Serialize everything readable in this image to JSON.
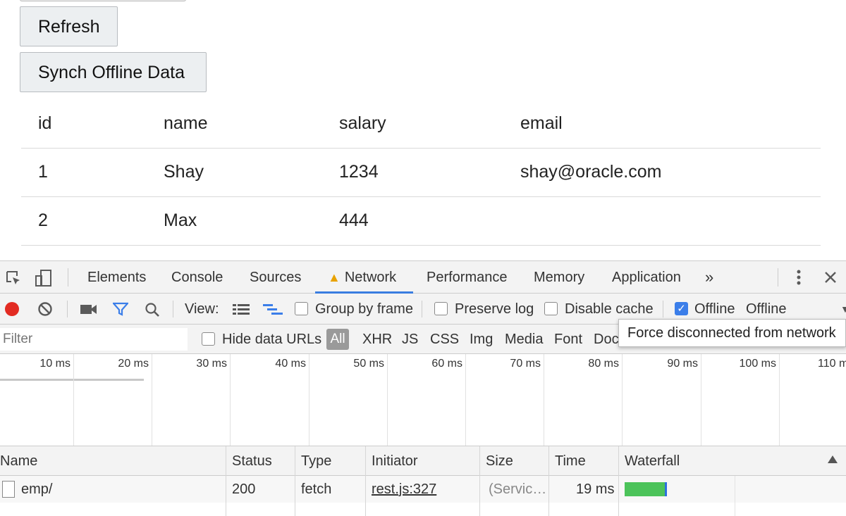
{
  "page": {
    "buttons": {
      "refresh": "Refresh",
      "synch": "Synch Offline Data"
    },
    "table": {
      "columns": [
        "id",
        "name",
        "salary",
        "email"
      ],
      "rows": [
        {
          "id": "1",
          "name": "Shay",
          "salary": "1234",
          "email": "shay@oracle.com"
        },
        {
          "id": "2",
          "name": "Max",
          "salary": "444",
          "email": ""
        }
      ]
    }
  },
  "devtools": {
    "tabs": [
      "Elements",
      "Console",
      "Sources",
      "Network",
      "Performance",
      "Memory",
      "Application"
    ],
    "active_tab": "Network",
    "more_tabs": "»",
    "toolbar": {
      "view_label": "View:",
      "group_by_frame": "Group by frame",
      "preserve_log": "Preserve log",
      "disable_cache": "Disable cache",
      "offline_checkbox": "Offline",
      "throttle_value": "Offline"
    },
    "filterbar": {
      "filter_placeholder": "Filter",
      "hide_data_urls": "Hide data URLs",
      "types": [
        "All",
        "XHR",
        "JS",
        "CSS",
        "Img",
        "Media",
        "Font",
        "Doc"
      ]
    },
    "tooltip": "Force disconnected from network",
    "timeline_ticks": [
      "10 ms",
      "20 ms",
      "30 ms",
      "40 ms",
      "50 ms",
      "60 ms",
      "70 ms",
      "80 ms",
      "90 ms",
      "100 ms",
      "110 ms"
    ],
    "grid": {
      "headers": [
        "Name",
        "Status",
        "Type",
        "Initiator",
        "Size",
        "Time",
        "Waterfall"
      ],
      "rows": [
        {
          "name": "emp/",
          "status": "200",
          "type": "fetch",
          "initiator": "rest.js:327",
          "size": "(Servic…",
          "time": "19 ms"
        }
      ]
    },
    "colors": {
      "accent": "#3a7de0",
      "record": "#e22b22",
      "waterfall_bar": "#4cc35a"
    },
    "icons": [
      "inspect-element-icon",
      "device-toolbar-icon",
      "warning-icon",
      "kebab-menu-icon",
      "close-icon",
      "record-icon",
      "clear-icon",
      "camera-icon",
      "filter-icon",
      "search-icon",
      "list-view-icon",
      "waterfall-view-icon",
      "dropdown-caret-icon",
      "document-icon",
      "sort-ascending-icon"
    ]
  }
}
